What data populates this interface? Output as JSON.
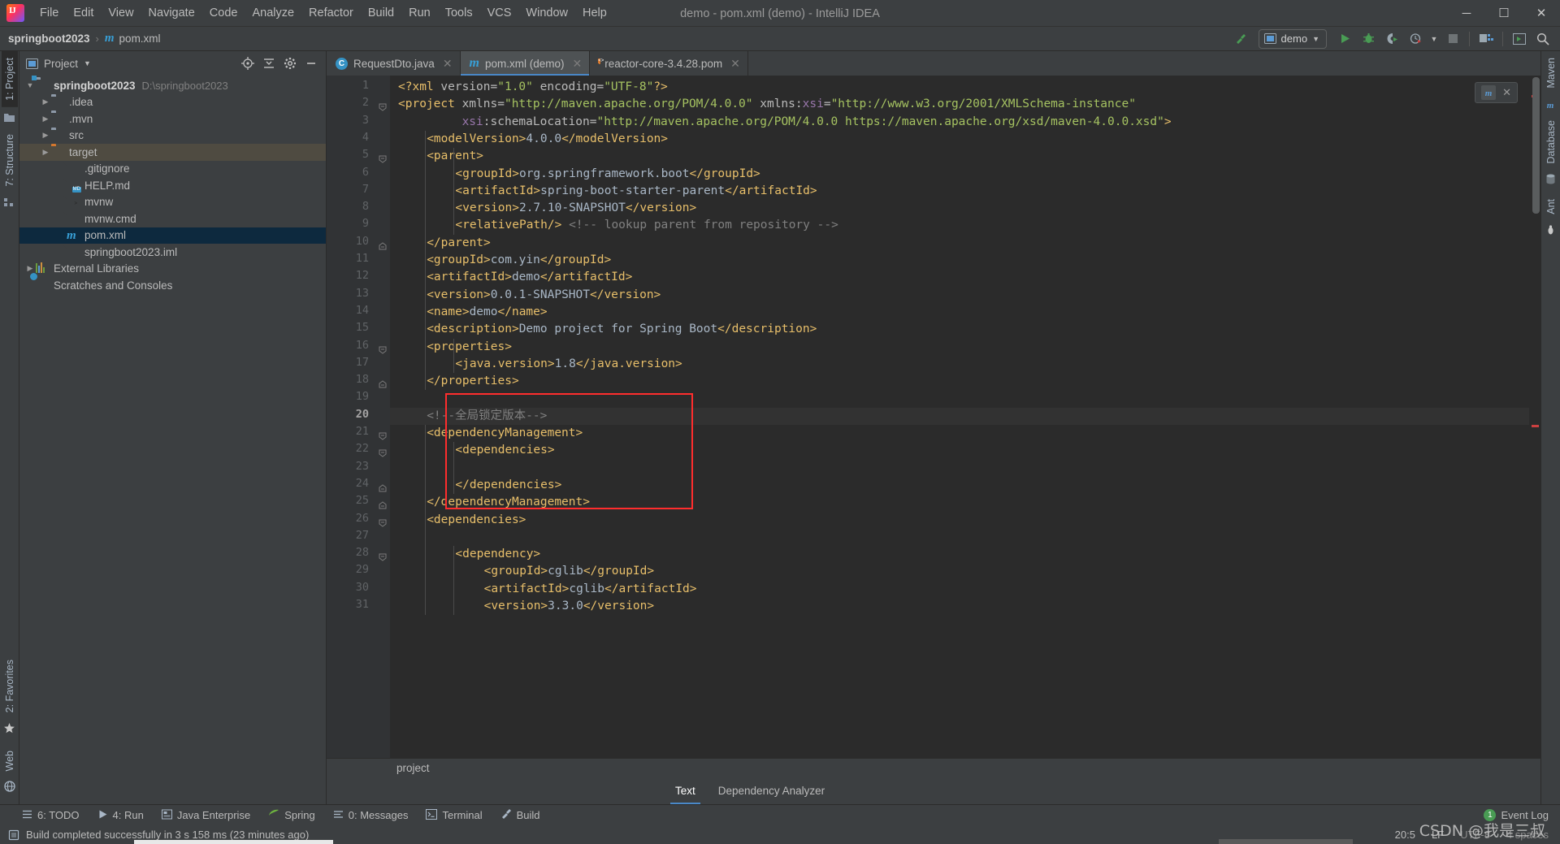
{
  "window": {
    "title": "demo - pom.xml (demo) - IntelliJ IDEA",
    "minimize": "─",
    "maximize": "☐",
    "close": "✕"
  },
  "menubar": {
    "items": [
      "File",
      "Edit",
      "View",
      "Navigate",
      "Code",
      "Analyze",
      "Refactor",
      "Build",
      "Run",
      "Tools",
      "VCS",
      "Window",
      "Help"
    ]
  },
  "navbar": {
    "breadcrumbs": [
      {
        "label": "springboot2023",
        "icon": ""
      },
      {
        "label": "pom.xml",
        "icon": "maven-m-icon"
      }
    ],
    "separator": "›",
    "run_config": "demo",
    "icons": [
      "build-hammer-icon",
      "run-icon",
      "debug-icon",
      "run-coverage-icon",
      "profiler-icon",
      "stop-icon",
      "open-project-structure-icon",
      "update-icon",
      "search-everywhere-icon"
    ]
  },
  "left_tool_strip": {
    "tabs": [
      {
        "label": "1: Project",
        "active": true
      },
      {
        "label": "7: Structure",
        "active": false
      }
    ],
    "bottom_tabs": [
      "2: Favorites",
      "Web"
    ]
  },
  "right_tool_strip": {
    "tabs": [
      "Maven",
      "Database",
      "Ant"
    ]
  },
  "project_panel": {
    "title": "Project",
    "header_icons": [
      "locate-icon",
      "collapse-all-icon",
      "settings-gear-icon",
      "hide-icon"
    ],
    "tree": [
      {
        "label": "springboot2023",
        "path": "D:\\springboot2023",
        "icon": "module-folder-icon",
        "arrow": "▼",
        "depth": 0,
        "bold": true,
        "state": "normal"
      },
      {
        "label": ".idea",
        "path": "",
        "icon": "folder-icon",
        "arrow": "▶",
        "depth": 1,
        "bold": false,
        "state": "normal"
      },
      {
        "label": ".mvn",
        "path": "",
        "icon": "folder-icon",
        "arrow": "▶",
        "depth": 1,
        "bold": false,
        "state": "normal"
      },
      {
        "label": "src",
        "path": "",
        "icon": "folder-icon",
        "arrow": "▶",
        "depth": 1,
        "bold": false,
        "state": "normal"
      },
      {
        "label": "target",
        "path": "",
        "icon": "folder-excluded-icon",
        "arrow": "▶",
        "depth": 1,
        "bold": false,
        "state": "highlighted"
      },
      {
        "label": ".gitignore",
        "path": "",
        "icon": "gitignore-file-icon",
        "arrow": "",
        "depth": 2,
        "bold": false,
        "state": "normal"
      },
      {
        "label": "HELP.md",
        "path": "",
        "icon": "markdown-file-icon",
        "arrow": "",
        "depth": 2,
        "bold": false,
        "state": "normal"
      },
      {
        "label": "mvnw",
        "path": "",
        "icon": "shell-script-icon",
        "arrow": "",
        "depth": 2,
        "bold": false,
        "state": "normal"
      },
      {
        "label": "mvnw.cmd",
        "path": "",
        "icon": "cmd-file-icon",
        "arrow": "",
        "depth": 2,
        "bold": false,
        "state": "normal"
      },
      {
        "label": "pom.xml",
        "path": "",
        "icon": "maven-pom-icon",
        "arrow": "",
        "depth": 2,
        "bold": false,
        "state": "selected"
      },
      {
        "label": "springboot2023.iml",
        "path": "",
        "icon": "iml-file-icon",
        "arrow": "",
        "depth": 2,
        "bold": false,
        "state": "normal"
      },
      {
        "label": "External Libraries",
        "path": "",
        "icon": "libraries-icon",
        "arrow": "▶",
        "depth": 0,
        "bold": false,
        "state": "normal"
      },
      {
        "label": "Scratches and Consoles",
        "path": "",
        "icon": "scratches-icon",
        "arrow": "",
        "depth": 0,
        "bold": false,
        "state": "normal"
      }
    ]
  },
  "editor": {
    "tabs": [
      {
        "label": "RequestDto.java",
        "icon": "java-class-icon",
        "active": false,
        "close": "✕"
      },
      {
        "label": "pom.xml (demo)",
        "icon": "maven-pom-icon",
        "active": true,
        "close": "✕"
      },
      {
        "label": "reactor-core-3.4.28.pom",
        "icon": "xml-file-icon",
        "active": false,
        "close": "✕"
      }
    ],
    "breadcrumb": "project",
    "bottom_tabs": [
      {
        "label": "Text",
        "active": true
      },
      {
        "label": "Dependency Analyzer",
        "active": false
      }
    ],
    "current_line": 20,
    "lines": [
      {
        "n": 1,
        "indent": 0,
        "fold": "",
        "tokens": [
          {
            "t": "tag",
            "v": "<?xml "
          },
          {
            "t": "attr",
            "v": "version="
          },
          {
            "t": "val",
            "v": "\"1.0\""
          },
          {
            "t": "attr",
            "v": " encoding="
          },
          {
            "t": "val",
            "v": "\"UTF-8\""
          },
          {
            "t": "tag",
            "v": "?>"
          }
        ]
      },
      {
        "n": 2,
        "indent": 0,
        "fold": "open",
        "tokens": [
          {
            "t": "tag",
            "v": "<project "
          },
          {
            "t": "attr",
            "v": "xmlns="
          },
          {
            "t": "val",
            "v": "\"http://maven.apache.org/POM/4.0.0\""
          },
          {
            "t": "attr",
            "v": " xmlns:"
          },
          {
            "t": "ns",
            "v": "xsi"
          },
          {
            "t": "attr",
            "v": "="
          },
          {
            "t": "val",
            "v": "\"http://www.w3.org/2001/XMLSchema-instance\""
          }
        ]
      },
      {
        "n": 3,
        "indent": 0,
        "fold": "",
        "tokens": [
          {
            "t": "txtv",
            "v": "         "
          },
          {
            "t": "ns",
            "v": "xsi"
          },
          {
            "t": "attr",
            "v": ":schemaLocation="
          },
          {
            "t": "val",
            "v": "\"http://maven.apache.org/POM/4.0.0 https://maven.apache.org/xsd/maven-4.0.0.xsd\""
          },
          {
            "t": "tag",
            "v": ">"
          }
        ]
      },
      {
        "n": 4,
        "indent": 1,
        "fold": "",
        "tokens": [
          {
            "t": "tag",
            "v": "<modelVersion>"
          },
          {
            "t": "txtv",
            "v": "4.0.0"
          },
          {
            "t": "tag",
            "v": "</modelVersion>"
          }
        ]
      },
      {
        "n": 5,
        "indent": 1,
        "fold": "open",
        "tokens": [
          {
            "t": "tag",
            "v": "<parent>"
          }
        ]
      },
      {
        "n": 6,
        "indent": 2,
        "fold": "",
        "tokens": [
          {
            "t": "tag",
            "v": "<groupId>"
          },
          {
            "t": "txtv",
            "v": "org.springframework.boot"
          },
          {
            "t": "tag",
            "v": "</groupId>"
          }
        ]
      },
      {
        "n": 7,
        "indent": 2,
        "fold": "",
        "tokens": [
          {
            "t": "tag",
            "v": "<artifactId>"
          },
          {
            "t": "txtv",
            "v": "spring-boot-starter-parent"
          },
          {
            "t": "tag",
            "v": "</artifactId>"
          }
        ]
      },
      {
        "n": 8,
        "indent": 2,
        "fold": "",
        "tokens": [
          {
            "t": "tag",
            "v": "<version>"
          },
          {
            "t": "txtv",
            "v": "2.7.10-SNAPSHOT"
          },
          {
            "t": "tag",
            "v": "</version>"
          }
        ]
      },
      {
        "n": 9,
        "indent": 2,
        "fold": "",
        "tokens": [
          {
            "t": "tag",
            "v": "<relativePath/>"
          },
          {
            "t": "cmt",
            "v": " <!-- lookup parent from repository -->"
          }
        ]
      },
      {
        "n": 10,
        "indent": 1,
        "fold": "close",
        "tokens": [
          {
            "t": "tag",
            "v": "</parent>"
          }
        ]
      },
      {
        "n": 11,
        "indent": 1,
        "fold": "",
        "tokens": [
          {
            "t": "tag",
            "v": "<groupId>"
          },
          {
            "t": "txtv",
            "v": "com.yin"
          },
          {
            "t": "tag",
            "v": "</groupId>"
          }
        ]
      },
      {
        "n": 12,
        "indent": 1,
        "fold": "",
        "tokens": [
          {
            "t": "tag",
            "v": "<artifactId>"
          },
          {
            "t": "txtv",
            "v": "demo"
          },
          {
            "t": "tag",
            "v": "</artifactId>"
          }
        ]
      },
      {
        "n": 13,
        "indent": 1,
        "fold": "",
        "tokens": [
          {
            "t": "tag",
            "v": "<version>"
          },
          {
            "t": "txtv",
            "v": "0.0.1-SNAPSHOT"
          },
          {
            "t": "tag",
            "v": "</version>"
          }
        ]
      },
      {
        "n": 14,
        "indent": 1,
        "fold": "",
        "tokens": [
          {
            "t": "tag",
            "v": "<name>"
          },
          {
            "t": "txtv",
            "v": "demo"
          },
          {
            "t": "tag",
            "v": "</name>"
          }
        ]
      },
      {
        "n": 15,
        "indent": 1,
        "fold": "",
        "tokens": [
          {
            "t": "tag",
            "v": "<description>"
          },
          {
            "t": "txtv",
            "v": "Demo project for Spring Boot"
          },
          {
            "t": "tag",
            "v": "</description>"
          }
        ]
      },
      {
        "n": 16,
        "indent": 1,
        "fold": "open",
        "tokens": [
          {
            "t": "tag",
            "v": "<properties>"
          }
        ]
      },
      {
        "n": 17,
        "indent": 2,
        "fold": "",
        "tokens": [
          {
            "t": "tag",
            "v": "<java.version>"
          },
          {
            "t": "txtv",
            "v": "1.8"
          },
          {
            "t": "tag",
            "v": "</java.version>"
          }
        ]
      },
      {
        "n": 18,
        "indent": 1,
        "fold": "close",
        "tokens": [
          {
            "t": "tag",
            "v": "</properties>"
          }
        ]
      },
      {
        "n": 19,
        "indent": 0,
        "fold": "",
        "tokens": []
      },
      {
        "n": 20,
        "indent": 1,
        "fold": "",
        "tokens": [
          {
            "t": "cmt",
            "v": "<!--全局锁定版本-->"
          }
        ]
      },
      {
        "n": 21,
        "indent": 1,
        "fold": "open",
        "tokens": [
          {
            "t": "tag",
            "v": "<dependencyManagement>"
          }
        ]
      },
      {
        "n": 22,
        "indent": 2,
        "fold": "open",
        "tokens": [
          {
            "t": "tag",
            "v": "<dependencies>"
          }
        ]
      },
      {
        "n": 23,
        "indent": 0,
        "fold": "",
        "tokens": []
      },
      {
        "n": 24,
        "indent": 2,
        "fold": "close",
        "tokens": [
          {
            "t": "tag",
            "v": "</dependencies>"
          }
        ]
      },
      {
        "n": 25,
        "indent": 1,
        "fold": "close",
        "tokens": [
          {
            "t": "tag",
            "v": "</dependencyManagement>"
          }
        ]
      },
      {
        "n": 26,
        "indent": 1,
        "fold": "open",
        "tokens": [
          {
            "t": "tag",
            "v": "<dependencies>"
          }
        ]
      },
      {
        "n": 27,
        "indent": 0,
        "fold": "",
        "tokens": []
      },
      {
        "n": 28,
        "indent": 2,
        "fold": "open",
        "tokens": [
          {
            "t": "tag",
            "v": "<dependency>"
          }
        ]
      },
      {
        "n": 29,
        "indent": 3,
        "fold": "",
        "tokens": [
          {
            "t": "tag",
            "v": "<groupId>"
          },
          {
            "t": "txtv",
            "v": "cglib"
          },
          {
            "t": "tag",
            "v": "</groupId>"
          }
        ]
      },
      {
        "n": 30,
        "indent": 3,
        "fold": "",
        "tokens": [
          {
            "t": "tag",
            "v": "<artifactId>"
          },
          {
            "t": "txtv",
            "v": "cglib"
          },
          {
            "t": "tag",
            "v": "</artifactId>"
          }
        ]
      },
      {
        "n": 31,
        "indent": 3,
        "fold": "",
        "tokens": [
          {
            "t": "tag",
            "v": "<version>"
          },
          {
            "t": "txtv",
            "v": "3.3.0"
          },
          {
            "t": "tag",
            "v": "</version>"
          }
        ]
      }
    ]
  },
  "status_tools": {
    "items": [
      {
        "label": "6: TODO",
        "icon": "todo-icon",
        "mnemonic": "6"
      },
      {
        "label": "4: Run",
        "icon": "run-icon",
        "mnemonic": "4"
      },
      {
        "label": "Java Enterprise",
        "icon": "java-ee-icon",
        "mnemonic": ""
      },
      {
        "label": "Spring",
        "icon": "spring-leaf-icon",
        "mnemonic": ""
      },
      {
        "label": "0: Messages",
        "icon": "messages-icon",
        "mnemonic": "0"
      },
      {
        "label": "Terminal",
        "icon": "terminal-icon",
        "mnemonic": ""
      },
      {
        "label": "Build",
        "icon": "build-hammer-icon",
        "mnemonic": ""
      }
    ],
    "event_log": "Event Log",
    "event_log_count": "1"
  },
  "statusbar": {
    "message": "Build completed successfully in 3 s 158 ms (23 minutes ago)",
    "caret": "20:5",
    "line_separator": "LF",
    "encoding": "UTF-8",
    "indent": "4 spaces",
    "watermark": "CSDN @我是三叔"
  },
  "colors": {
    "accent": "#4a88c7",
    "selection": "#0d293e",
    "highlight_box": "#ff2d2d",
    "panel_bg": "#3c3f41",
    "editor_bg": "#2b2b2b",
    "tag": "#e8bf6a",
    "value": "#a5c261",
    "comment": "#808080"
  }
}
